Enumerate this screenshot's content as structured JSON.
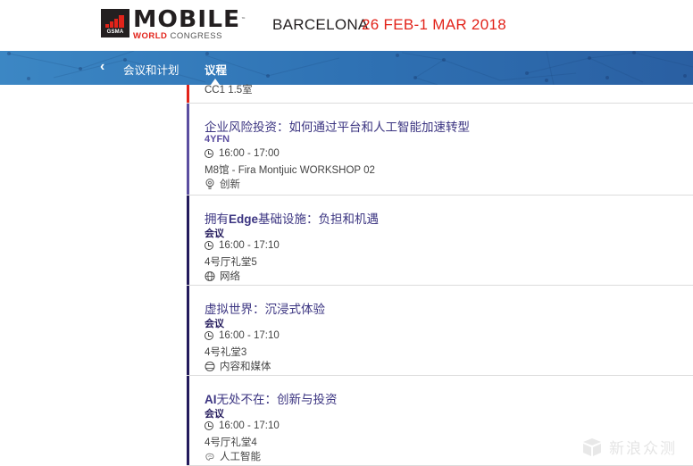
{
  "header": {
    "logo": {
      "gsma": "GSMA",
      "mobile": "MOBILE",
      "world": "WORLD",
      "congress": "CONGRESS",
      "tm": "™"
    },
    "city": "BARCELONA",
    "dates": "26 FEB-1 MAR 2018",
    "colors": {
      "brand_red": "#e2231a",
      "dark": "#231f20"
    }
  },
  "nav": {
    "back_icon": "chevron-left-icon",
    "back_glyph": "‹",
    "previous": "会议和计划",
    "current": "议程",
    "colors": {
      "bar": "#2f72b4"
    }
  },
  "sessions_partial": {
    "room": "CC1 1.5室",
    "accent": "#e2231a"
  },
  "sessions": [
    {
      "title_bold": "",
      "title": "企业风险投资：如何通过平台和人工智能加速转型",
      "track": "4YFN",
      "track_color": "#5b4ea0",
      "accent": "#5b4ea0",
      "time": "16:00 - 17:00",
      "venue": "M8馆 - Fira Montjuic WORKSHOP 02",
      "topic_icon": "lightbulb-icon",
      "topic": "创新"
    },
    {
      "title_bold": "Edge",
      "title_pre": "拥有",
      "title": "基础设施：负担和机遇",
      "track": "会议",
      "track_color": "#231a5c",
      "accent": "#231a5c",
      "time": "16:00 - 17:10",
      "venue": "4号厅礼堂5",
      "topic_icon": "globe-network-icon",
      "topic": "网络"
    },
    {
      "title_bold": "",
      "title": "虚拟世界：沉浸式体验",
      "track": "会议",
      "track_color": "#231a5c",
      "accent": "#231a5c",
      "time": "16:00 - 17:10",
      "venue": "4号礼堂3",
      "topic_icon": "media-content-icon",
      "topic": "内容和媒体"
    },
    {
      "title_bold": "AI",
      "title": "无处不在：创新与投资",
      "track": "会议",
      "track_color": "#231a5c",
      "accent": "#231a5c",
      "time": "16:00 - 17:10",
      "venue": "4号厅礼堂4",
      "topic_icon": "brain-ai-icon",
      "topic": "人工智能"
    }
  ],
  "watermark": {
    "icon": "sina-zhongce-logo-icon",
    "text": "新浪众测"
  }
}
